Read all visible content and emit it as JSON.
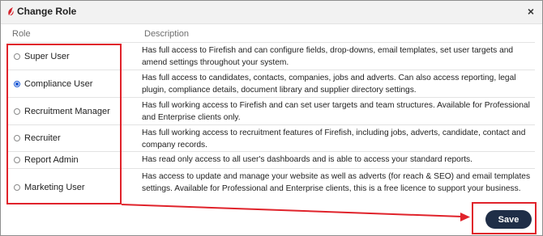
{
  "dialog": {
    "title": "Change Role",
    "close_glyph": "×",
    "icon": "firefish-logo-icon"
  },
  "table": {
    "headers": {
      "role": "Role",
      "description": "Description"
    },
    "rows": [
      {
        "role": "Super User",
        "selected": false,
        "description": "Has full access to Firefish and can configure fields, drop-downs, email templates, set user targets and amend settings throughout your system."
      },
      {
        "role": "Compliance User",
        "selected": true,
        "description": "Has full access to candidates, contacts, companies, jobs and adverts. Can also access reporting, legal plugin, compliance details, document library and supplier directory settings."
      },
      {
        "role": "Recruitment Manager",
        "selected": false,
        "description": "Has full working access to Firefish and can set user targets and team structures. Available for Professional and Enterprise clients only."
      },
      {
        "role": "Recruiter",
        "selected": false,
        "description": "Has full working access to recruitment features of Firefish, including jobs, adverts, candidate, contact and company records."
      },
      {
        "role": "Report Admin",
        "selected": false,
        "description": "Has read only access to all user's dashboards and is able to access your standard reports."
      },
      {
        "role": "Marketing User",
        "selected": false,
        "description": "Has access to update and manage your website as well as adverts (for reach & SEO) and email templates settings. Available for Professional and Enterprise clients, this is a free licence to support your business."
      }
    ]
  },
  "footer": {
    "save_label": "Save"
  },
  "colors": {
    "annotation": "#e0232b",
    "save_button": "#1f2e47",
    "radio_selected": "#1a57d4",
    "logo": "#d4202a"
  }
}
